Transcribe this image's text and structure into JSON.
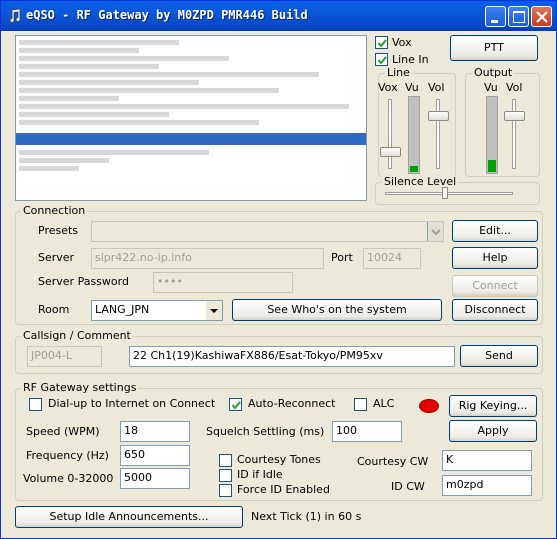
{
  "window": {
    "title": "eQSO - RF Gateway by M0ZPD PMR446 Build",
    "title_icon": "note-icon",
    "controls": [
      "minimize-icon",
      "maximize-icon",
      "close-icon"
    ]
  },
  "audio": {
    "vox_label": "Vox",
    "vox_checked": true,
    "linein_label": "Line In",
    "linein_checked": true,
    "ptt_label": "PTT",
    "line_group": "Line",
    "line_vox": "Vox",
    "line_vu": "Vu",
    "line_vol": "Vol",
    "output_group": "Output",
    "output_vu": "Vu",
    "output_vol": "Vol",
    "silence_group": "Silence Level",
    "line_vu_level": 0.08,
    "output_vu_level": 0.16
  },
  "connection": {
    "group": "Connection",
    "presets_label": "Presets",
    "presets_value": "",
    "edit_label": "Edit...",
    "server_label": "Server",
    "server_value": "slpr422.no-ip.info",
    "port_label": "Port",
    "port_value": "10024",
    "help_label": "Help",
    "password_label": "Server Password",
    "password_value": "••••",
    "connect_label": "Connect",
    "room_label": "Room",
    "room_value": "LANG_JPN",
    "whos_on_label": "See Who's on the system",
    "disconnect_label": "Disconnect"
  },
  "callsign": {
    "group": "Callsign / Comment",
    "callsign_value": "JP004-L",
    "comment_value": "22 Ch1(19)KashiwaFX886/Esat-Tokyo/PM95xv",
    "send_label": "Send"
  },
  "rf": {
    "group": "RF Gateway settings",
    "dialup_label": "Dial-up to Internet on Connect",
    "dialup_checked": false,
    "autoreconnect_label": "Auto-Reconnect",
    "autoreconnect_checked": true,
    "alc_label": "ALC",
    "alc_checked": false,
    "rig_keying_label": "Rig Keying...",
    "speed_label": "Speed (WPM)",
    "speed_value": "18",
    "squelch_label": "Squelch Settling (ms)",
    "squelch_value": "100",
    "apply_label": "Apply",
    "frequency_label": "Frequency (Hz)",
    "frequency_value": "650",
    "courtesy_tones_label": "Courtesy Tones",
    "courtesy_tones_checked": false,
    "courtesy_cw_label": "Courtesy CW",
    "courtesy_cw_value": "K",
    "volume_label": "Volume 0-32000",
    "volume_value": "5000",
    "id_if_idle_label": "ID if Idle",
    "id_if_idle_checked": false,
    "force_id_label": "Force ID Enabled",
    "force_id_checked": false,
    "id_cw_label": "ID CW",
    "id_cw_value": "m0zpd",
    "led_color": "#e40000"
  },
  "footer": {
    "setup_idle_label": "Setup Idle Announcements...",
    "next_tick": "Next Tick (1) in 60 s"
  }
}
